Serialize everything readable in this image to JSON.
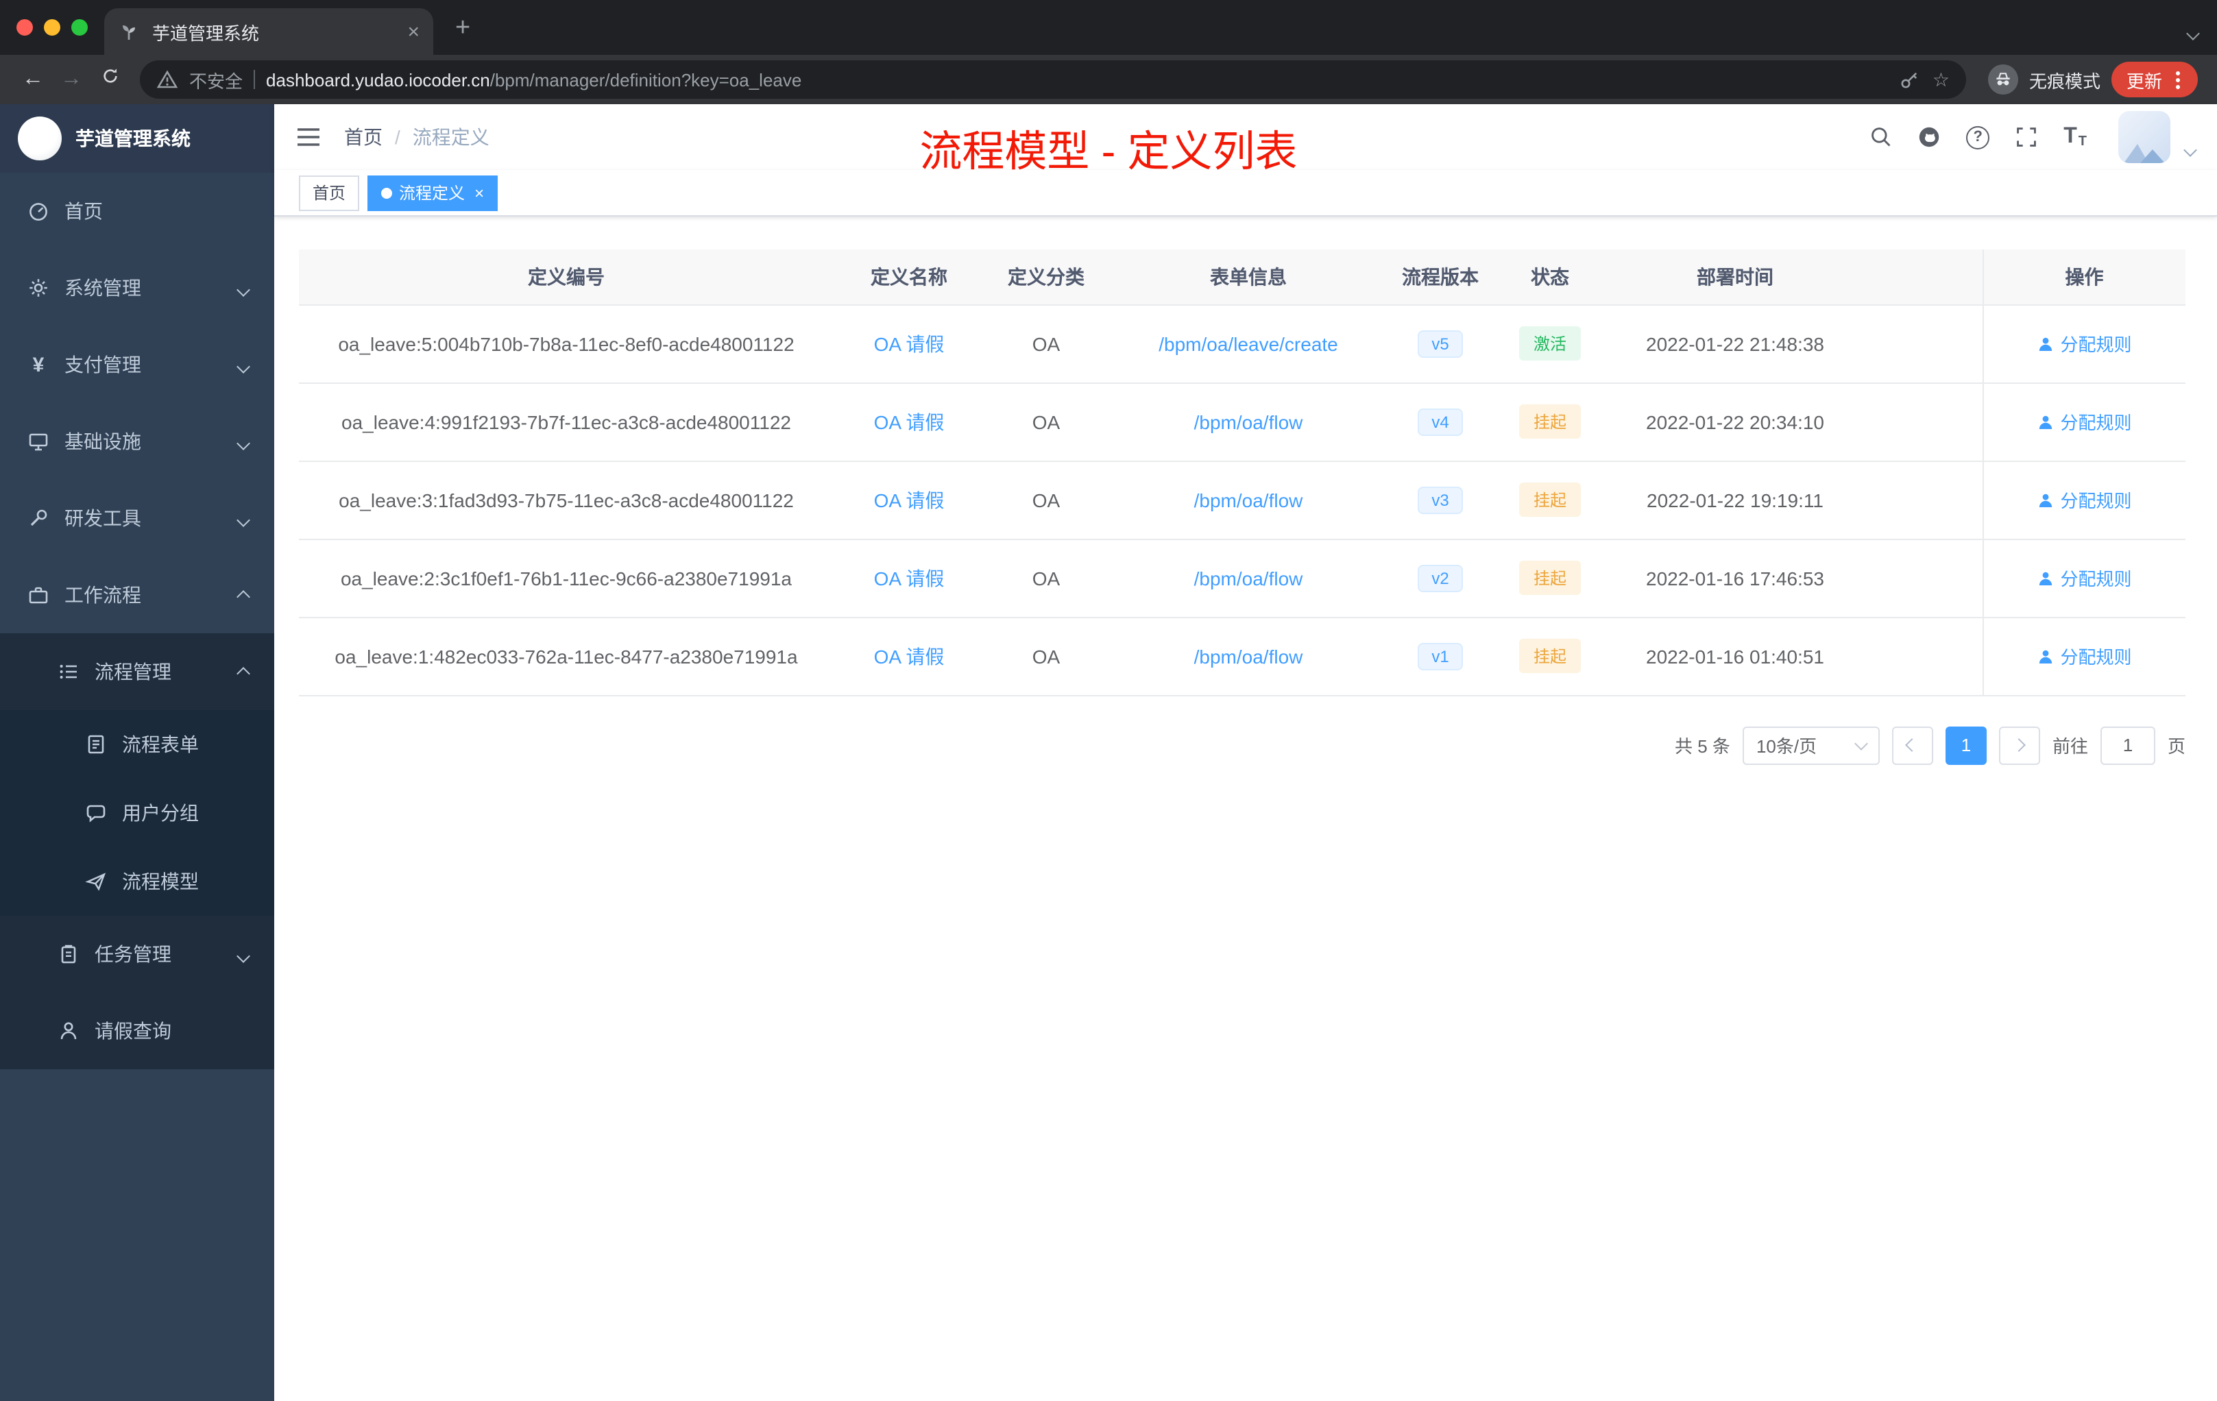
{
  "browser": {
    "tab_title": "芋道管理系统",
    "security_label": "不安全",
    "url_domain": "dashboard.yudao.iocoder.cn",
    "url_path": "/bpm/manager/definition?key=oa_leave",
    "incognito_label": "无痕模式",
    "update_label": "更新"
  },
  "icons": {
    "close": "×",
    "new_tab": "+",
    "back": "←",
    "forward": "→",
    "star": "☆",
    "question": "?",
    "yen": "¥",
    "font_size": "T"
  },
  "sidebar": {
    "title": "芋道管理系统",
    "items": {
      "home": "首页",
      "system": "系统管理",
      "pay": "支付管理",
      "infra": "基础设施",
      "dev": "研发工具",
      "workflow": "工作流程",
      "process": "流程管理",
      "form": "流程表单",
      "group": "用户分组",
      "model": "流程模型",
      "task": "任务管理",
      "leave": "请假查询"
    }
  },
  "navbar": {
    "breadcrumb_home": "首页",
    "breadcrumb_current": "流程定义"
  },
  "annotation": "流程模型 - 定义列表",
  "tags": {
    "home": "首页",
    "active": "流程定义"
  },
  "table": {
    "columns": [
      "定义编号",
      "定义名称",
      "定义分类",
      "表单信息",
      "流程版本",
      "状态",
      "部署时间",
      "操作"
    ],
    "rows": [
      {
        "id": "oa_leave:5:004b710b-7b8a-11ec-8ef0-acde48001122",
        "name": "OA 请假",
        "category": "OA",
        "form": "/bpm/oa/leave/create",
        "version": "v5",
        "status": "激活",
        "status_type": "tag-success",
        "time": "2022-01-22 21:48:38",
        "action": "分配规则"
      },
      {
        "id": "oa_leave:4:991f2193-7b7f-11ec-a3c8-acde48001122",
        "name": "OA 请假",
        "category": "OA",
        "form": "/bpm/oa/flow",
        "version": "v4",
        "status": "挂起",
        "status_type": "tag-warning",
        "time": "2022-01-22 20:34:10",
        "action": "分配规则"
      },
      {
        "id": "oa_leave:3:1fad3d93-7b75-11ec-a3c8-acde48001122",
        "name": "OA 请假",
        "category": "OA",
        "form": "/bpm/oa/flow",
        "version": "v3",
        "status": "挂起",
        "status_type": "tag-warning",
        "time": "2022-01-22 19:19:11",
        "action": "分配规则"
      },
      {
        "id": "oa_leave:2:3c1f0ef1-76b1-11ec-9c66-a2380e71991a",
        "name": "OA 请假",
        "category": "OA",
        "form": "/bpm/oa/flow",
        "version": "v2",
        "status": "挂起",
        "status_type": "tag-warning",
        "time": "2022-01-16 17:46:53",
        "action": "分配规则"
      },
      {
        "id": "oa_leave:1:482ec033-762a-11ec-8477-a2380e71991a",
        "name": "OA 请假",
        "category": "OA",
        "form": "/bpm/oa/flow",
        "version": "v1",
        "status": "挂起",
        "status_type": "tag-warning",
        "time": "2022-01-16 01:40:51",
        "action": "分配规则"
      }
    ]
  },
  "pagination": {
    "total": "共 5 条",
    "page_size": "10条/页",
    "current": "1",
    "goto_label": "前往",
    "goto_value": "1",
    "unit": "页"
  },
  "colors": {
    "accent": "#409eff",
    "success": "#23b75f",
    "warning": "#eda53c",
    "annotation_red": "#f21a07",
    "sidebar_bg": "#304156"
  }
}
